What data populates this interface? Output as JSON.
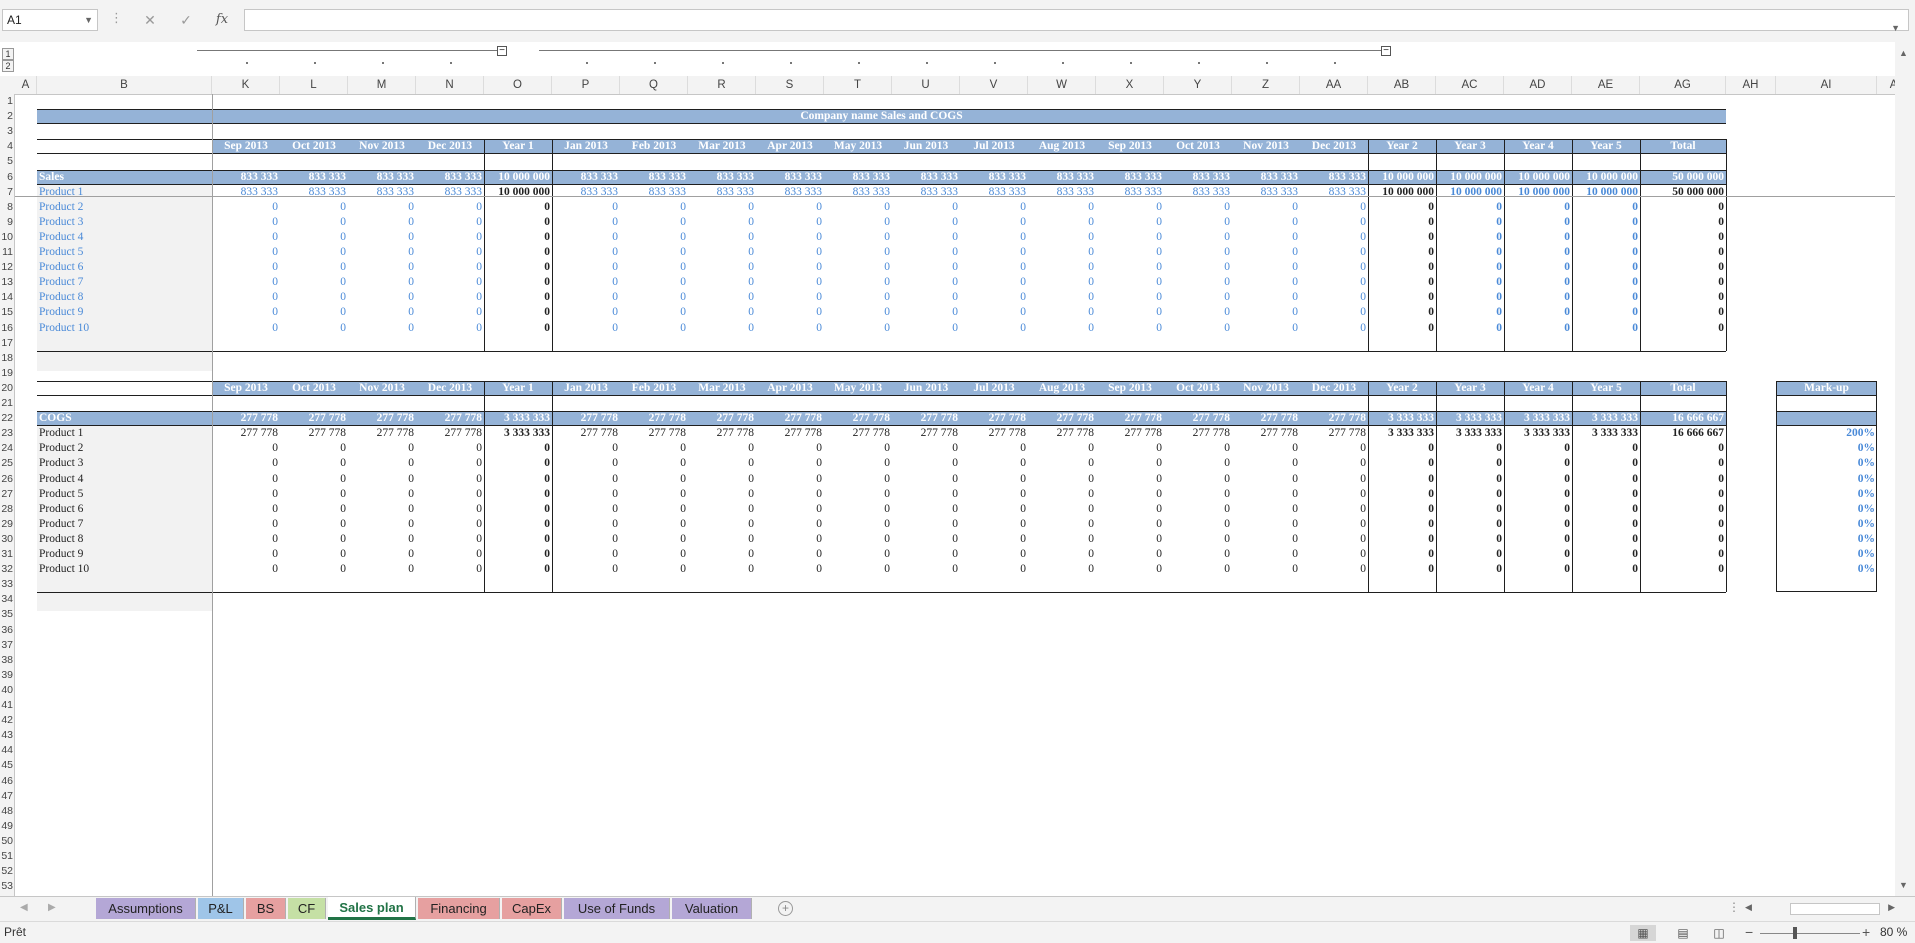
{
  "formula_bar": {
    "name_box": "A1",
    "formula": ""
  },
  "outline": {
    "levels": [
      "1",
      "2"
    ]
  },
  "column_headers": [
    "A",
    "B",
    "K",
    "L",
    "M",
    "N",
    "O",
    "P",
    "Q",
    "R",
    "S",
    "T",
    "U",
    "V",
    "W",
    "X",
    "Y",
    "Z",
    "AA",
    "AB",
    "AC",
    "AD",
    "AE",
    "AG",
    "AH",
    "AI",
    "AJ"
  ],
  "row_numbers": [
    "1",
    "2",
    "3",
    "4",
    "5",
    "6",
    "7",
    "8",
    "9",
    "10",
    "11",
    "12",
    "13",
    "14",
    "15",
    "16",
    "17",
    "18",
    "19",
    "20",
    "21",
    "22",
    "23",
    "24",
    "25",
    "26",
    "27",
    "28",
    "29",
    "30",
    "31",
    "32",
    "33",
    "34",
    "35",
    "36",
    "37",
    "38",
    "39",
    "40",
    "41",
    "42",
    "43",
    "44",
    "45",
    "46",
    "47",
    "48",
    "49",
    "50",
    "51",
    "52",
    "53"
  ],
  "sheet": {
    "title": "Company name Sales and COGS",
    "periods": [
      "Sep 2013",
      "Oct 2013",
      "Nov 2013",
      "Dec 2013",
      "Year 1",
      "Jan 2013",
      "Feb 2013",
      "Mar 2013",
      "Apr 2013",
      "May 2013",
      "Jun 2013",
      "Jul 2013",
      "Aug 2013",
      "Sep 2013",
      "Oct 2013",
      "Nov 2013",
      "Dec 2013",
      "Year 2",
      "Year 3",
      "Year 4",
      "Year 5",
      "Total"
    ],
    "sales": {
      "label": "Sales",
      "totals": [
        "833 333",
        "833 333",
        "833 333",
        "833 333",
        "10 000 000",
        "833 333",
        "833 333",
        "833 333",
        "833 333",
        "833 333",
        "833 333",
        "833 333",
        "833 333",
        "833 333",
        "833 333",
        "833 333",
        "833 333",
        "10 000 000",
        "10 000 000",
        "10 000 000",
        "10 000 000",
        "50 000 000"
      ],
      "products": [
        {
          "name": "Product 1",
          "values": [
            "833 333",
            "833 333",
            "833 333",
            "833 333",
            "10 000 000",
            "833 333",
            "833 333",
            "833 333",
            "833 333",
            "833 333",
            "833 333",
            "833 333",
            "833 333",
            "833 333",
            "833 333",
            "833 333",
            "833 333",
            "10 000 000",
            "10 000 000",
            "10 000 000",
            "10 000 000",
            "50 000 000"
          ]
        },
        {
          "name": "Product 2",
          "values": [
            "0",
            "0",
            "0",
            "0",
            "0",
            "0",
            "0",
            "0",
            "0",
            "0",
            "0",
            "0",
            "0",
            "0",
            "0",
            "0",
            "0",
            "0",
            "0",
            "0",
            "0",
            "0"
          ]
        },
        {
          "name": "Product 3",
          "values": [
            "0",
            "0",
            "0",
            "0",
            "0",
            "0",
            "0",
            "0",
            "0",
            "0",
            "0",
            "0",
            "0",
            "0",
            "0",
            "0",
            "0",
            "0",
            "0",
            "0",
            "0",
            "0"
          ]
        },
        {
          "name": "Product 4",
          "values": [
            "0",
            "0",
            "0",
            "0",
            "0",
            "0",
            "0",
            "0",
            "0",
            "0",
            "0",
            "0",
            "0",
            "0",
            "0",
            "0",
            "0",
            "0",
            "0",
            "0",
            "0",
            "0"
          ]
        },
        {
          "name": "Product 5",
          "values": [
            "0",
            "0",
            "0",
            "0",
            "0",
            "0",
            "0",
            "0",
            "0",
            "0",
            "0",
            "0",
            "0",
            "0",
            "0",
            "0",
            "0",
            "0",
            "0",
            "0",
            "0",
            "0"
          ]
        },
        {
          "name": "Product 6",
          "values": [
            "0",
            "0",
            "0",
            "0",
            "0",
            "0",
            "0",
            "0",
            "0",
            "0",
            "0",
            "0",
            "0",
            "0",
            "0",
            "0",
            "0",
            "0",
            "0",
            "0",
            "0",
            "0"
          ]
        },
        {
          "name": "Product 7",
          "values": [
            "0",
            "0",
            "0",
            "0",
            "0",
            "0",
            "0",
            "0",
            "0",
            "0",
            "0",
            "0",
            "0",
            "0",
            "0",
            "0",
            "0",
            "0",
            "0",
            "0",
            "0",
            "0"
          ]
        },
        {
          "name": "Product 8",
          "values": [
            "0",
            "0",
            "0",
            "0",
            "0",
            "0",
            "0",
            "0",
            "0",
            "0",
            "0",
            "0",
            "0",
            "0",
            "0",
            "0",
            "0",
            "0",
            "0",
            "0",
            "0",
            "0"
          ]
        },
        {
          "name": "Product 9",
          "values": [
            "0",
            "0",
            "0",
            "0",
            "0",
            "0",
            "0",
            "0",
            "0",
            "0",
            "0",
            "0",
            "0",
            "0",
            "0",
            "0",
            "0",
            "0",
            "0",
            "0",
            "0",
            "0"
          ]
        },
        {
          "name": "Product 10",
          "values": [
            "0",
            "0",
            "0",
            "0",
            "0",
            "0",
            "0",
            "0",
            "0",
            "0",
            "0",
            "0",
            "0",
            "0",
            "0",
            "0",
            "0",
            "0",
            "0",
            "0",
            "0",
            "0"
          ]
        }
      ]
    },
    "cogs": {
      "label": "COGS",
      "totals": [
        "277 778",
        "277 778",
        "277 778",
        "277 778",
        "3 333 333",
        "277 778",
        "277 778",
        "277 778",
        "277 778",
        "277 778",
        "277 778",
        "277 778",
        "277 778",
        "277 778",
        "277 778",
        "277 778",
        "277 778",
        "3 333 333",
        "3 333 333",
        "3 333 333",
        "3 333 333",
        "16 666 667"
      ],
      "markup_header": "Mark-up",
      "products": [
        {
          "name": "Product 1",
          "markup": "200%",
          "values": [
            "277 778",
            "277 778",
            "277 778",
            "277 778",
            "3 333 333",
            "277 778",
            "277 778",
            "277 778",
            "277 778",
            "277 778",
            "277 778",
            "277 778",
            "277 778",
            "277 778",
            "277 778",
            "277 778",
            "277 778",
            "3 333 333",
            "3 333 333",
            "3 333 333",
            "3 333 333",
            "16 666 667"
          ]
        },
        {
          "name": "Product 2",
          "markup": "0%",
          "values": [
            "0",
            "0",
            "0",
            "0",
            "0",
            "0",
            "0",
            "0",
            "0",
            "0",
            "0",
            "0",
            "0",
            "0",
            "0",
            "0",
            "0",
            "0",
            "0",
            "0",
            "0",
            "0"
          ]
        },
        {
          "name": "Product 3",
          "markup": "0%",
          "values": [
            "0",
            "0",
            "0",
            "0",
            "0",
            "0",
            "0",
            "0",
            "0",
            "0",
            "0",
            "0",
            "0",
            "0",
            "0",
            "0",
            "0",
            "0",
            "0",
            "0",
            "0",
            "0"
          ]
        },
        {
          "name": "Product 4",
          "markup": "0%",
          "values": [
            "0",
            "0",
            "0",
            "0",
            "0",
            "0",
            "0",
            "0",
            "0",
            "0",
            "0",
            "0",
            "0",
            "0",
            "0",
            "0",
            "0",
            "0",
            "0",
            "0",
            "0",
            "0"
          ]
        },
        {
          "name": "Product 5",
          "markup": "0%",
          "values": [
            "0",
            "0",
            "0",
            "0",
            "0",
            "0",
            "0",
            "0",
            "0",
            "0",
            "0",
            "0",
            "0",
            "0",
            "0",
            "0",
            "0",
            "0",
            "0",
            "0",
            "0",
            "0"
          ]
        },
        {
          "name": "Product 6",
          "markup": "0%",
          "values": [
            "0",
            "0",
            "0",
            "0",
            "0",
            "0",
            "0",
            "0",
            "0",
            "0",
            "0",
            "0",
            "0",
            "0",
            "0",
            "0",
            "0",
            "0",
            "0",
            "0",
            "0",
            "0"
          ]
        },
        {
          "name": "Product 7",
          "markup": "0%",
          "values": [
            "0",
            "0",
            "0",
            "0",
            "0",
            "0",
            "0",
            "0",
            "0",
            "0",
            "0",
            "0",
            "0",
            "0",
            "0",
            "0",
            "0",
            "0",
            "0",
            "0",
            "0",
            "0"
          ]
        },
        {
          "name": "Product 8",
          "markup": "0%",
          "values": [
            "0",
            "0",
            "0",
            "0",
            "0",
            "0",
            "0",
            "0",
            "0",
            "0",
            "0",
            "0",
            "0",
            "0",
            "0",
            "0",
            "0",
            "0",
            "0",
            "0",
            "0",
            "0"
          ]
        },
        {
          "name": "Product 9",
          "markup": "0%",
          "values": [
            "0",
            "0",
            "0",
            "0",
            "0",
            "0",
            "0",
            "0",
            "0",
            "0",
            "0",
            "0",
            "0",
            "0",
            "0",
            "0",
            "0",
            "0",
            "0",
            "0",
            "0",
            "0"
          ]
        },
        {
          "name": "Product 10",
          "markup": "0%",
          "values": [
            "0",
            "0",
            "0",
            "0",
            "0",
            "0",
            "0",
            "0",
            "0",
            "0",
            "0",
            "0",
            "0",
            "0",
            "0",
            "0",
            "0",
            "0",
            "0",
            "0",
            "0",
            "0"
          ]
        }
      ]
    }
  },
  "tabs": [
    {
      "label": "Assumptions",
      "color": "#b4a7d6"
    },
    {
      "label": "P&L",
      "color": "#9fc5e8"
    },
    {
      "label": "BS",
      "color": "#e6a0a0"
    },
    {
      "label": "CF",
      "color": "#c5e0a5"
    },
    {
      "label": "Sales plan",
      "color": "#ffffff",
      "active": true
    },
    {
      "label": "Financing",
      "color": "#e6a0a0"
    },
    {
      "label": "CapEx",
      "color": "#e6a0a0"
    },
    {
      "label": "Use of Funds",
      "color": "#b4a7d6"
    },
    {
      "label": "Valuation",
      "color": "#b4a7d6"
    }
  ],
  "status": {
    "text": "Prêt",
    "zoom": "80 %"
  },
  "colors": {
    "header_band": "#95b3d7",
    "input_blue": "#4a8ad8",
    "active_tab": "#217346"
  }
}
